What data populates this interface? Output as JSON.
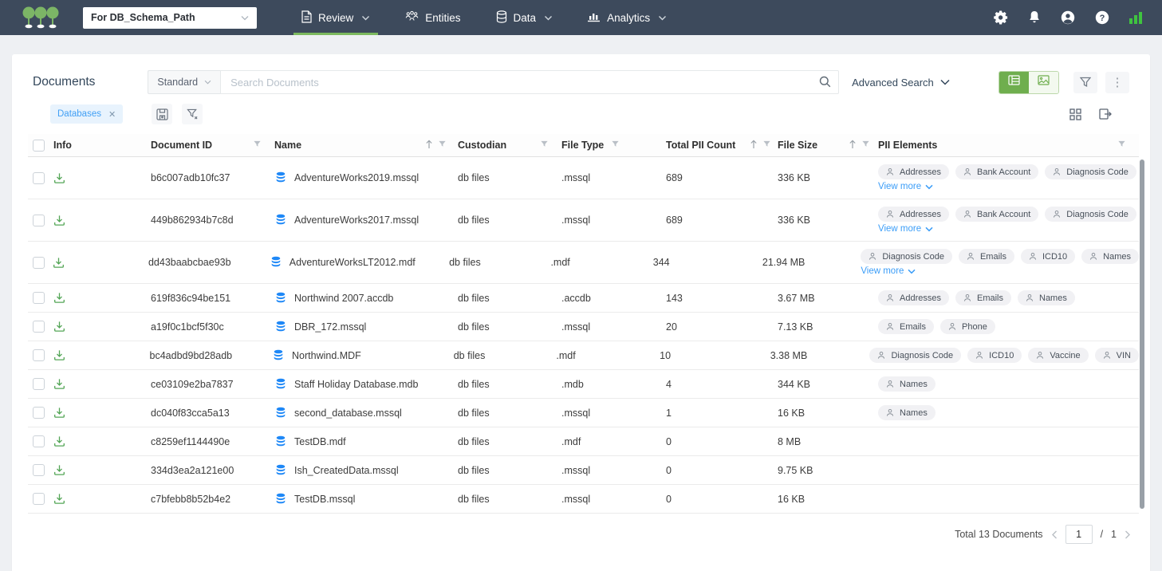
{
  "navbar": {
    "project_selector": "For DB_Schema_Path",
    "tabs": {
      "review": "Review",
      "entities": "Entities",
      "data": "Data",
      "analytics": "Analytics"
    }
  },
  "toolbar": {
    "page_title": "Documents",
    "search_scope": "Standard",
    "search_placeholder": "Search Documents",
    "advanced_search": "Advanced Search"
  },
  "filters": {
    "chip_label": "Databases",
    "chip_remove": "✕"
  },
  "table": {
    "headers": {
      "info": "Info",
      "document_id": "Document ID",
      "name": "Name",
      "custodian": "Custodian",
      "file_type": "File Type",
      "total_pii_count": "Total PII Count",
      "file_size": "File Size",
      "pii_elements": "PII Elements"
    },
    "view_more_label": "View more",
    "rows": [
      {
        "id": "b6c007adb10fc37",
        "name": "AdventureWorks2019.mssql",
        "custodian": "db files",
        "file_type": ".mssql",
        "pii_count": "689",
        "file_size": "336 KB",
        "pii_elements": [
          "Addresses",
          "Bank Account",
          "Diagnosis Code"
        ],
        "view_more": true
      },
      {
        "id": "449b862934b7c8d",
        "name": "AdventureWorks2017.mssql",
        "custodian": "db files",
        "file_type": ".mssql",
        "pii_count": "689",
        "file_size": "336 KB",
        "pii_elements": [
          "Addresses",
          "Bank Account",
          "Diagnosis Code"
        ],
        "view_more": true
      },
      {
        "id": "dd43baabcbae93b",
        "name": "AdventureWorksLT2012.mdf",
        "custodian": "db files",
        "file_type": ".mdf",
        "pii_count": "344",
        "file_size": "21.94 MB",
        "pii_elements": [
          "Diagnosis Code",
          "Emails",
          "ICD10",
          "Names"
        ],
        "view_more": true
      },
      {
        "id": "619f836c94be151",
        "name": "Northwind 2007.accdb",
        "custodian": "db files",
        "file_type": ".accdb",
        "pii_count": "143",
        "file_size": "3.67 MB",
        "pii_elements": [
          "Addresses",
          "Emails",
          "Names"
        ],
        "view_more": false
      },
      {
        "id": "a19f0c1bcf5f30c",
        "name": "DBR_172.mssql",
        "custodian": "db files",
        "file_type": ".mssql",
        "pii_count": "20",
        "file_size": "7.13 KB",
        "pii_elements": [
          "Emails",
          "Phone"
        ],
        "view_more": false
      },
      {
        "id": "bc4adbd9bd28adb",
        "name": "Northwind.MDF",
        "custodian": "db files",
        "file_type": ".mdf",
        "pii_count": "10",
        "file_size": "3.38 MB",
        "pii_elements": [
          "Diagnosis Code",
          "ICD10",
          "Vaccine",
          "VIN"
        ],
        "view_more": false
      },
      {
        "id": "ce03109e2ba7837",
        "name": "Staff Holiday Database.mdb",
        "custodian": "db files",
        "file_type": ".mdb",
        "pii_count": "4",
        "file_size": "344 KB",
        "pii_elements": [
          "Names"
        ],
        "view_more": false
      },
      {
        "id": "dc040f83cca5a13",
        "name": "second_database.mssql",
        "custodian": "db files",
        "file_type": ".mssql",
        "pii_count": "1",
        "file_size": "16 KB",
        "pii_elements": [
          "Names"
        ],
        "view_more": false
      },
      {
        "id": "c8259ef1144490e",
        "name": "TestDB.mdf",
        "custodian": "db files",
        "file_type": ".mdf",
        "pii_count": "0",
        "file_size": "8 MB",
        "pii_elements": [],
        "view_more": false
      },
      {
        "id": "334d3ea2a121e00",
        "name": "Ish_CreatedData.mssql",
        "custodian": "db files",
        "file_type": ".mssql",
        "pii_count": "0",
        "file_size": "9.75 KB",
        "pii_elements": [],
        "view_more": false
      },
      {
        "id": "c7bfebb8b52b4e2",
        "name": "TestDB.mssql",
        "custodian": "db files",
        "file_type": ".mssql",
        "pii_count": "0",
        "file_size": "16 KB",
        "pii_elements": [],
        "view_more": false
      }
    ]
  },
  "footer": {
    "total_label": "Total 13 Documents",
    "current_page": "1",
    "separator": "/",
    "total_pages": "1"
  },
  "colors": {
    "navbar_bg": "#3d4a5c",
    "accent_green": "#6fae4e",
    "logo_green": "#7cb566",
    "link_blue": "#3b9df8",
    "chip_blue_bg": "#e8f3fd",
    "db_icon_blue": "#1e88f7",
    "download_green": "#53a556"
  }
}
